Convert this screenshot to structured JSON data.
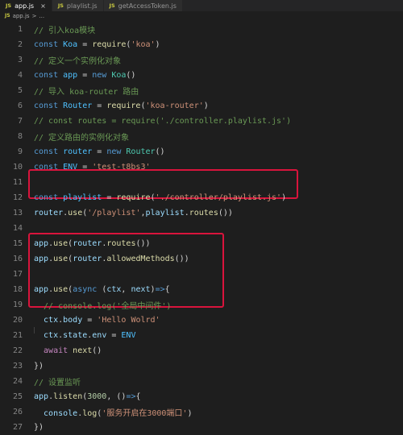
{
  "tabs": [
    {
      "icon": "JS",
      "label": "app.js",
      "close": "×",
      "active": true
    },
    {
      "icon": "JS",
      "label": "playlist.js",
      "active": false
    },
    {
      "icon": "JS",
      "label": "getAccessToken.js",
      "active": false
    }
  ],
  "breadcrumb": {
    "icon": "JS",
    "file": "app.js",
    "separator": ">",
    "ellipsis": "..."
  },
  "lines": [
    {
      "n": "1",
      "tokens": [
        {
          "t": "// 引入koa模块",
          "c": "c"
        }
      ]
    },
    {
      "n": "2",
      "tokens": [
        {
          "t": "const ",
          "c": "k"
        },
        {
          "t": "Koa",
          "c": "ct"
        },
        {
          "t": " = ",
          "c": "p"
        },
        {
          "t": "require",
          "c": "f"
        },
        {
          "t": "(",
          "c": "p"
        },
        {
          "t": "'koa'",
          "c": "s"
        },
        {
          "t": ")",
          "c": "p"
        }
      ]
    },
    {
      "n": "3",
      "tokens": [
        {
          "t": "// 定义一个实例化对象",
          "c": "c"
        }
      ]
    },
    {
      "n": "4",
      "tokens": [
        {
          "t": "const ",
          "c": "k"
        },
        {
          "t": "app",
          "c": "ct"
        },
        {
          "t": " = ",
          "c": "p"
        },
        {
          "t": "new ",
          "c": "k"
        },
        {
          "t": "Koa",
          "c": "t"
        },
        {
          "t": "()",
          "c": "p"
        }
      ]
    },
    {
      "n": "5",
      "tokens": [
        {
          "t": "// 导入 koa-router 路由",
          "c": "c"
        }
      ]
    },
    {
      "n": "6",
      "tokens": [
        {
          "t": "const ",
          "c": "k"
        },
        {
          "t": "Router",
          "c": "ct"
        },
        {
          "t": " = ",
          "c": "p"
        },
        {
          "t": "require",
          "c": "f"
        },
        {
          "t": "(",
          "c": "p"
        },
        {
          "t": "'koa-router'",
          "c": "s"
        },
        {
          "t": ")",
          "c": "p"
        }
      ]
    },
    {
      "n": "7",
      "tokens": [
        {
          "t": "// const routes = require('./controller.playlist.js')",
          "c": "c"
        }
      ]
    },
    {
      "n": "8",
      "tokens": [
        {
          "t": "// 定义路由的实例化对象",
          "c": "c"
        }
      ]
    },
    {
      "n": "9",
      "tokens": [
        {
          "t": "const ",
          "c": "k"
        },
        {
          "t": "router",
          "c": "ct"
        },
        {
          "t": " = ",
          "c": "p"
        },
        {
          "t": "new ",
          "c": "k"
        },
        {
          "t": "Router",
          "c": "t"
        },
        {
          "t": "()",
          "c": "p"
        }
      ]
    },
    {
      "n": "10",
      "tokens": [
        {
          "t": "const ",
          "c": "k"
        },
        {
          "t": "ENV",
          "c": "ct"
        },
        {
          "t": " = ",
          "c": "p"
        },
        {
          "t": "'test-t8bs3'",
          "c": "s"
        }
      ]
    },
    {
      "n": "11",
      "tokens": []
    },
    {
      "n": "12",
      "tokens": [
        {
          "t": "const ",
          "c": "k"
        },
        {
          "t": "playlist",
          "c": "ct"
        },
        {
          "t": " = ",
          "c": "p"
        },
        {
          "t": "require",
          "c": "f"
        },
        {
          "t": "(",
          "c": "p"
        },
        {
          "t": "'./controller/playlist.js'",
          "c": "s"
        },
        {
          "t": ")",
          "c": "p"
        }
      ]
    },
    {
      "n": "13",
      "tokens": [
        {
          "t": "router",
          "c": "v"
        },
        {
          "t": ".",
          "c": "p"
        },
        {
          "t": "use",
          "c": "f"
        },
        {
          "t": "(",
          "c": "p"
        },
        {
          "t": "'/playlist'",
          "c": "s"
        },
        {
          "t": ",",
          "c": "p"
        },
        {
          "t": "playlist",
          "c": "v"
        },
        {
          "t": ".",
          "c": "p"
        },
        {
          "t": "routes",
          "c": "f"
        },
        {
          "t": "())",
          "c": "p"
        }
      ]
    },
    {
      "n": "14",
      "tokens": []
    },
    {
      "n": "15",
      "tokens": [
        {
          "t": "app",
          "c": "v"
        },
        {
          "t": ".",
          "c": "p"
        },
        {
          "t": "use",
          "c": "f"
        },
        {
          "t": "(",
          "c": "p"
        },
        {
          "t": "router",
          "c": "v"
        },
        {
          "t": ".",
          "c": "p"
        },
        {
          "t": "routes",
          "c": "f"
        },
        {
          "t": "())",
          "c": "p"
        }
      ]
    },
    {
      "n": "16",
      "tokens": [
        {
          "t": "app",
          "c": "v"
        },
        {
          "t": ".",
          "c": "p"
        },
        {
          "t": "use",
          "c": "f"
        },
        {
          "t": "(",
          "c": "p"
        },
        {
          "t": "router",
          "c": "v"
        },
        {
          "t": ".",
          "c": "p"
        },
        {
          "t": "allowedMethods",
          "c": "f"
        },
        {
          "t": "())",
          "c": "p"
        }
      ]
    },
    {
      "n": "17",
      "tokens": []
    },
    {
      "n": "18",
      "tokens": [
        {
          "t": "app",
          "c": "v"
        },
        {
          "t": ".",
          "c": "p"
        },
        {
          "t": "use",
          "c": "f"
        },
        {
          "t": "(",
          "c": "p"
        },
        {
          "t": "async ",
          "c": "k"
        },
        {
          "t": "(",
          "c": "p"
        },
        {
          "t": "ctx",
          "c": "v"
        },
        {
          "t": ", ",
          "c": "p"
        },
        {
          "t": "next",
          "c": "v"
        },
        {
          "t": ")",
          "c": "p"
        },
        {
          "t": "=>",
          "c": "k"
        },
        {
          "t": "{",
          "c": "p"
        }
      ]
    },
    {
      "n": "19",
      "tokens": [
        {
          "t": "  // console.log('全局中间件')",
          "c": "c"
        }
      ]
    },
    {
      "n": "20",
      "tokens": [
        {
          "t": "  ctx",
          "c": "v"
        },
        {
          "t": ".",
          "c": "p"
        },
        {
          "t": "body",
          "c": "v"
        },
        {
          "t": " = ",
          "c": "p"
        },
        {
          "t": "'Hello Wolrd'",
          "c": "s"
        }
      ]
    },
    {
      "n": "21",
      "tokens": [
        {
          "t": "  ctx",
          "c": "v"
        },
        {
          "t": ".",
          "c": "p"
        },
        {
          "t": "state",
          "c": "v"
        },
        {
          "t": ".",
          "c": "p"
        },
        {
          "t": "env",
          "c": "v"
        },
        {
          "t": " = ",
          "c": "p"
        },
        {
          "t": "ENV",
          "c": "ct"
        }
      ]
    },
    {
      "n": "22",
      "tokens": [
        {
          "t": "  await ",
          "c": "ctl"
        },
        {
          "t": "next",
          "c": "f"
        },
        {
          "t": "()",
          "c": "p"
        }
      ]
    },
    {
      "n": "23",
      "tokens": [
        {
          "t": "})",
          "c": "p"
        }
      ]
    },
    {
      "n": "24",
      "tokens": [
        {
          "t": "// 设置监听",
          "c": "c"
        }
      ]
    },
    {
      "n": "25",
      "tokens": [
        {
          "t": "app",
          "c": "v"
        },
        {
          "t": ".",
          "c": "p"
        },
        {
          "t": "listen",
          "c": "f"
        },
        {
          "t": "(",
          "c": "p"
        },
        {
          "t": "3000",
          "c": "n"
        },
        {
          "t": ", ",
          "c": "p"
        },
        {
          "t": "()",
          "c": "p"
        },
        {
          "t": "=>",
          "c": "k"
        },
        {
          "t": "{",
          "c": "p"
        }
      ]
    },
    {
      "n": "26",
      "tokens": [
        {
          "t": "  console",
          "c": "v"
        },
        {
          "t": ".",
          "c": "p"
        },
        {
          "t": "log",
          "c": "f"
        },
        {
          "t": "(",
          "c": "p"
        },
        {
          "t": "'服务开启在3000端口'",
          "c": "s"
        },
        {
          "t": ")",
          "c": "p"
        }
      ]
    },
    {
      "n": "27",
      "tokens": [
        {
          "t": "})",
          "c": "p"
        }
      ]
    }
  ],
  "colors": {
    "highlight_box": "#d9143c"
  }
}
